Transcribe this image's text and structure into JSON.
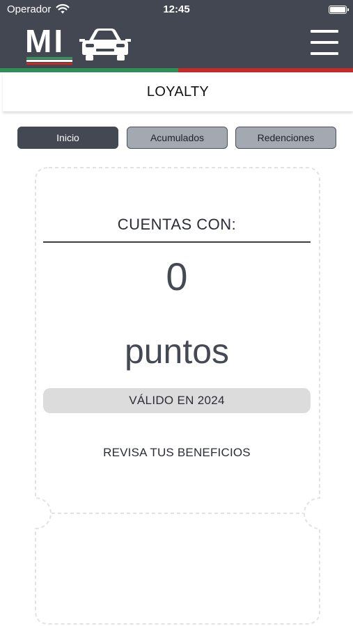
{
  "status_bar": {
    "carrier": "Operador",
    "time": "12:45"
  },
  "header": {
    "logo_text": "MI",
    "page_title": "LOYALTY",
    "menu_icon": "hamburger-menu-icon"
  },
  "colors": {
    "header_bg": "#424751",
    "flag_green": "#2f8f56",
    "flag_red": "#c62a2a",
    "tab_active": "#434852",
    "tab_inactive": "#a4a8b1"
  },
  "tabs": [
    {
      "label": "Inicio",
      "active": true
    },
    {
      "label": "Acumulados",
      "active": false
    },
    {
      "label": "Redenciones",
      "active": false
    }
  ],
  "card": {
    "label": "CUENTAS CON:",
    "points_value": "0",
    "points_unit": "puntos",
    "validity": "VÁLIDO EN 2024",
    "benefits_link": "REVISA TUS BENEFICIOS"
  }
}
